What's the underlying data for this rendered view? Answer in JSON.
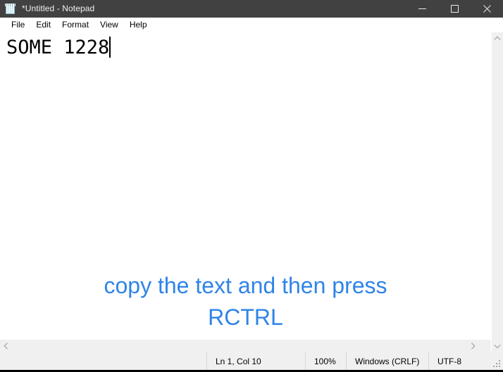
{
  "window": {
    "title": "*Untitled - Notepad",
    "icon": "notepad-icon",
    "controls": {
      "minimize": "minimize-icon",
      "maximize": "maximize-icon",
      "close": "close-icon"
    },
    "titlebar_color": "#414141",
    "title_text_color": "#f0f0f0"
  },
  "menubar": {
    "items": [
      {
        "label": "File"
      },
      {
        "label": "Edit"
      },
      {
        "label": "Format"
      },
      {
        "label": "View"
      },
      {
        "label": "Help"
      }
    ]
  },
  "editor": {
    "document_text": "SOME 1228",
    "caret_visible": true,
    "background": "#ffffff",
    "text_color": "#000000"
  },
  "overlay": {
    "hint_line1": "copy the text and then press",
    "hint_line2": "RCTRL",
    "color": "#2f84e8"
  },
  "scrollbars": {
    "vertical": {
      "up_arrow": "chevron-up-icon",
      "down_arrow": "chevron-down-icon"
    },
    "horizontal": {
      "left_arrow": "chevron-left-icon",
      "right_arrow": "chevron-right-icon"
    }
  },
  "statusbar": {
    "position": "Ln 1, Col 10",
    "zoom": "100%",
    "line_ending": "Windows (CRLF)",
    "encoding": "UTF-8",
    "grip": "resize-grip-icon"
  }
}
